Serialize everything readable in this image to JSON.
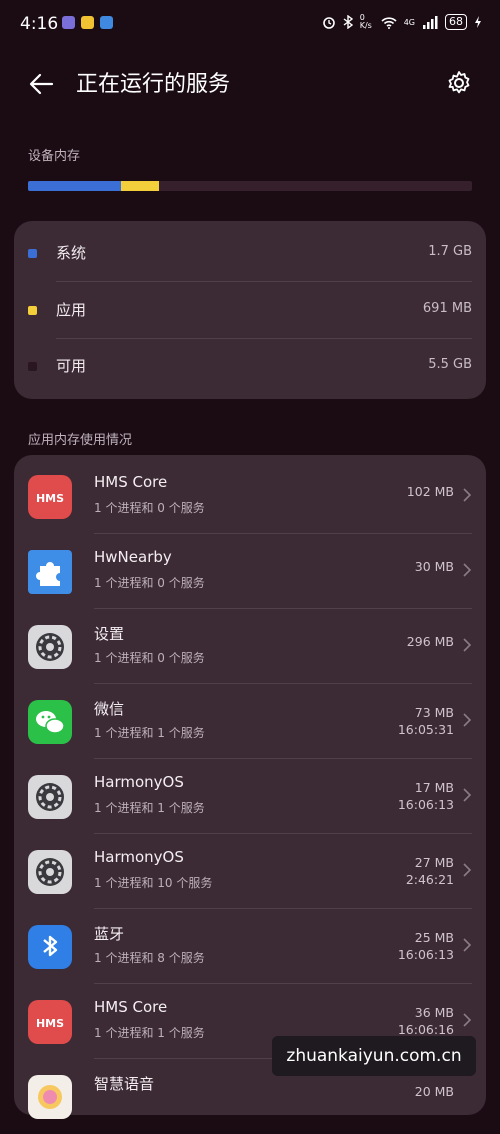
{
  "status_bar": {
    "time": "4:16",
    "net_speed": "0 K/s",
    "signal": "4G",
    "battery": "68"
  },
  "header": {
    "title": "正在运行的服务"
  },
  "device_memory": {
    "label": "设备内存",
    "bar": {
      "system_fraction": 0.21,
      "apps_fraction": 0.085
    },
    "items": [
      {
        "label": "系统",
        "value": "1.7 GB",
        "color": "#3b6fd6"
      },
      {
        "label": "应用",
        "value": "691 MB",
        "color": "#f4cf3c"
      },
      {
        "label": "可用",
        "value": "5.5 GB",
        "color": "#2a1621"
      }
    ]
  },
  "app_memory": {
    "label": "应用内存使用情况",
    "apps": [
      {
        "name": "HMS Core",
        "sub": "1 个进程和 0 个服务",
        "size": "102 MB",
        "time": "",
        "icon": "hms-icon"
      },
      {
        "name": "HwNearby",
        "sub": "1 个进程和 0 个服务",
        "size": "30 MB",
        "time": "",
        "icon": "puzzle-icon"
      },
      {
        "name": "设置",
        "sub": "1 个进程和 0 个服务",
        "size": "296 MB",
        "time": "",
        "icon": "settings-app-icon"
      },
      {
        "name": "微信",
        "sub": "1 个进程和 1 个服务",
        "size": "73 MB",
        "time": "16:05:31",
        "icon": "wechat-icon"
      },
      {
        "name": "HarmonyOS",
        "sub": "1 个进程和 1 个服务",
        "size": "17 MB",
        "time": "16:06:13",
        "icon": "settings-app-icon"
      },
      {
        "name": "HarmonyOS",
        "sub": "1 个进程和 10 个服务",
        "size": "27 MB",
        "time": "2:46:21",
        "icon": "settings-app-icon"
      },
      {
        "name": "蓝牙",
        "sub": "1 个进程和 8 个服务",
        "size": "25 MB",
        "time": "16:06:13",
        "icon": "bluetooth-icon"
      },
      {
        "name": "HMS Core",
        "sub": "1 个进程和 1 个服务",
        "size": "36 MB",
        "time": "16:06:16",
        "icon": "hms-icon"
      },
      {
        "name": "智慧语音",
        "sub": "",
        "size": "20 MB",
        "time": "",
        "icon": "voice-assistant-icon"
      }
    ]
  },
  "watermark": "zhuankaiyun.com.cn"
}
